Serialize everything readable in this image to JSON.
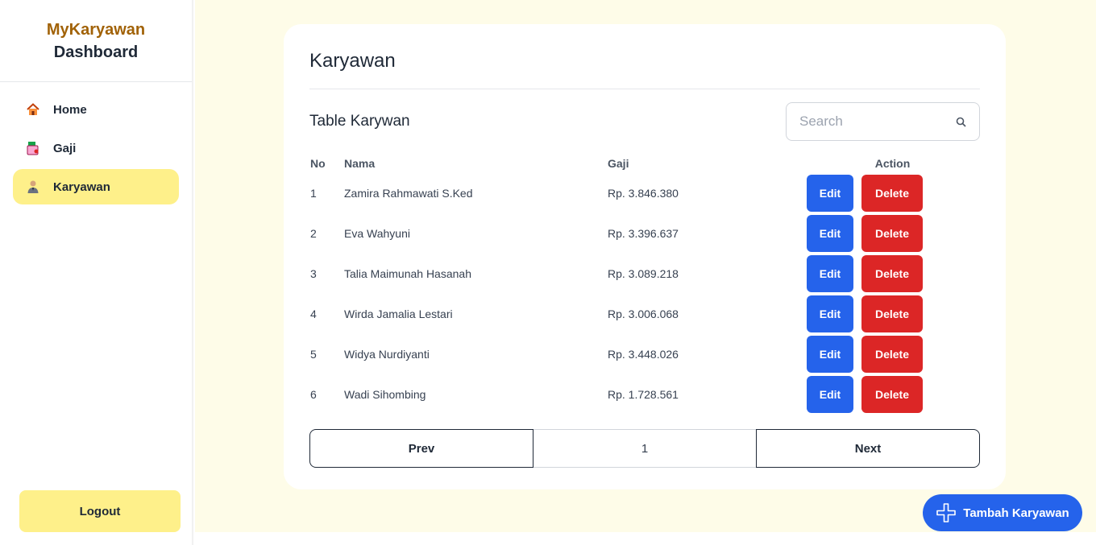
{
  "sidebar": {
    "brand_name": "MyKaryawan",
    "brand_sub": "Dashboard",
    "items": [
      {
        "label": "Home",
        "icon": "home-icon"
      },
      {
        "label": "Gaji",
        "icon": "wallet-icon"
      },
      {
        "label": "Karyawan",
        "icon": "employee-icon",
        "active": true
      }
    ],
    "logout_label": "Logout"
  },
  "main": {
    "title": "Karyawan",
    "table_title": "Table Karywan",
    "search_placeholder": "Search",
    "columns": [
      "No",
      "Nama",
      "Gaji",
      "Action"
    ],
    "rows": [
      {
        "no": "1",
        "nama": "Zamira Rahmawati S.Ked",
        "gaji": "Rp. 3.846.380"
      },
      {
        "no": "2",
        "nama": "Eva Wahyuni",
        "gaji": "Rp. 3.396.637"
      },
      {
        "no": "3",
        "nama": "Talia Maimunah Hasanah",
        "gaji": "Rp. 3.089.218"
      },
      {
        "no": "4",
        "nama": "Wirda Jamalia Lestari",
        "gaji": "Rp. 3.006.068"
      },
      {
        "no": "5",
        "nama": "Widya Nurdiyanti",
        "gaji": "Rp. 3.448.026"
      },
      {
        "no": "6",
        "nama": "Wadi Sihombing",
        "gaji": "Rp. 1.728.561"
      }
    ],
    "edit_label": "Edit",
    "delete_label": "Delete",
    "pagination": {
      "prev": "Prev",
      "page": "1",
      "next": "Next"
    }
  },
  "fab": {
    "label": "Tambah Karyawan",
    "icon": "plus-icon"
  },
  "colors": {
    "accent_yellow": "#fef08a",
    "brand_brown": "#a16207",
    "primary_blue": "#2563eb",
    "danger_red": "#dc2626",
    "background": "#fefce8"
  }
}
